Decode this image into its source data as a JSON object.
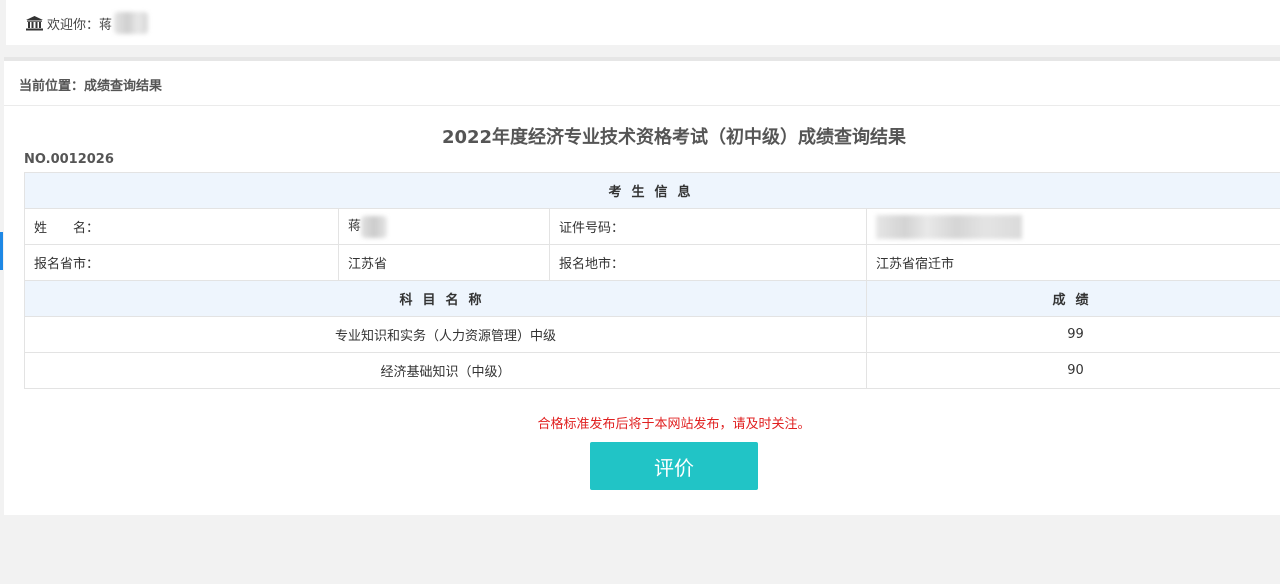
{
  "header": {
    "welcome_label": "欢迎你：",
    "user_name_visible": "蒋"
  },
  "breadcrumb": {
    "text": "当前位置：成绩查询结果"
  },
  "report": {
    "title": "2022年度经济专业技术资格考试（初中级）成绩查询结果",
    "serial_no": "NO.0012026"
  },
  "candidate": {
    "section_header": "考生信息",
    "name_label": "姓　　名：",
    "name_value_visible": "蒋",
    "id_label": "证件号码：",
    "province_label": "报名省市：",
    "province_value": "江苏省",
    "city_label": "报名地市：",
    "city_value": "江苏省宿迁市"
  },
  "scores": {
    "subject_header": "科目名称",
    "score_header": "成绩",
    "rows": [
      {
        "subject": "专业知识和实务（人力资源管理）中级",
        "score": "99"
      },
      {
        "subject": "经济基础知识（中级）",
        "score": "90"
      }
    ]
  },
  "notice": "合格标准发布后将于本网站发布，请及时关注。",
  "actions": {
    "evaluate_label": "评价"
  },
  "colors": {
    "button": "#21c4c6",
    "notice": "#e02020",
    "table_header_bg": "#eef5fd"
  }
}
